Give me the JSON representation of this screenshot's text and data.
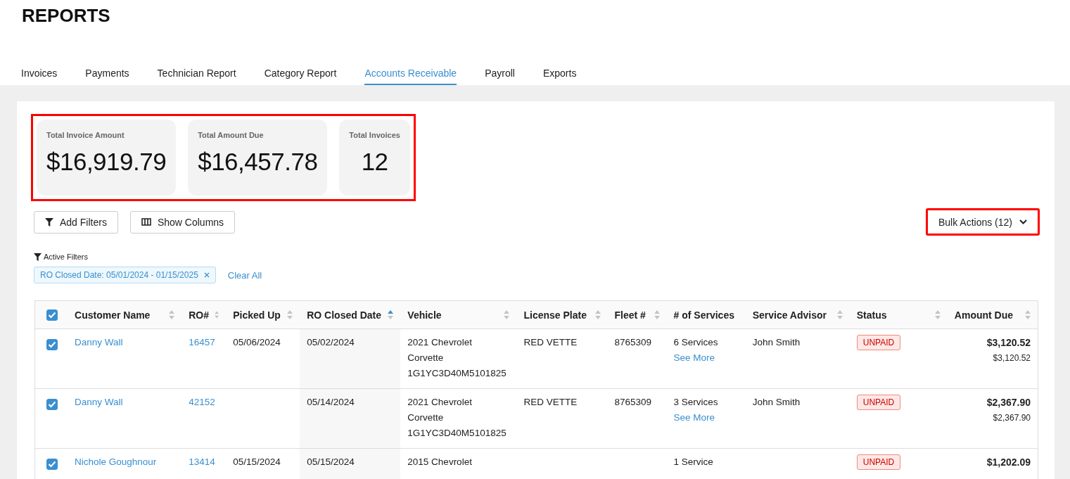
{
  "page_title": "REPORTS",
  "tabs": [
    {
      "label": "Invoices",
      "selected": false
    },
    {
      "label": "Payments",
      "selected": false
    },
    {
      "label": "Technician Report",
      "selected": false
    },
    {
      "label": "Category Report",
      "selected": false
    },
    {
      "label": "Accounts Receivable",
      "selected": true
    },
    {
      "label": "Payroll",
      "selected": false
    },
    {
      "label": "Exports",
      "selected": false
    }
  ],
  "summary": {
    "highlighted": true,
    "cards": [
      {
        "label": "Total Invoice Amount",
        "value": "$16,919.79"
      },
      {
        "label": "Total Amount Due",
        "value": "$16,457.78"
      },
      {
        "label": "Total Invoices",
        "value": "12"
      }
    ]
  },
  "toolbar": {
    "buttons": [
      {
        "label": "Add Filters",
        "kind": "filter"
      },
      {
        "label": "Show Columns",
        "kind": "columns"
      }
    ],
    "bulk_actions": {
      "label": "Bulk Actions (12)",
      "highlighted": true
    }
  },
  "active_filters": {
    "title": "Active Filters",
    "chips": [
      {
        "label": "RO Closed Date: 05/01/2024 - 01/15/2025"
      }
    ],
    "clear_label": "Clear All"
  },
  "table": {
    "select_all_checked": true,
    "columns": [
      {
        "label": "Customer Name",
        "kind": "sortable"
      },
      {
        "label": "RO#",
        "kind": "sortable"
      },
      {
        "label": "Picked Up",
        "kind": "sortable"
      },
      {
        "label": "RO Closed Date",
        "kind": "sorted"
      },
      {
        "label": "Vehicle",
        "kind": "sortable"
      },
      {
        "label": "License Plate",
        "kind": "sortable"
      },
      {
        "label": "Fleet #",
        "kind": "sortable"
      },
      {
        "label": "# of Services",
        "kind": "plain"
      },
      {
        "label": "Service Advisor",
        "kind": "sortable"
      },
      {
        "label": "Status",
        "kind": "sortable"
      },
      {
        "label": "Amount Due",
        "kind": "sortable"
      }
    ],
    "rows": [
      {
        "checked": true,
        "customer": "Danny Wall",
        "ro": "16457",
        "picked_up": "05/06/2024",
        "closed_date": "05/02/2024",
        "vehicle": "2021 Chevrolet Corvette 1G1YC3D40M5101825",
        "license_plate": "RED VETTE",
        "fleet": "8765309",
        "services": "6 Services",
        "see_more": "See More",
        "advisor": "John Smith",
        "status": "UNPAID",
        "amount_due": "$3,120.52",
        "amount_detail": "$3,120.52"
      },
      {
        "checked": true,
        "customer": "Danny Wall",
        "ro": "42152",
        "closed_date": "05/14/2024",
        "vehicle": "2021 Chevrolet Corvette 1G1YC3D40M5101825",
        "license_plate": "RED VETTE",
        "fleet": "8765309",
        "services": "3 Services",
        "see_more": "See More",
        "advisor": "John Smith",
        "status": "UNPAID",
        "amount_due": "$2,367.90",
        "amount_detail": "$2,367.90"
      },
      {
        "checked": true,
        "customer": "Nichole Goughnour",
        "ro": "13414",
        "picked_up": "05/15/2024",
        "closed_date": "05/15/2024",
        "vehicle": "2015 Chevrolet",
        "services": "1 Service",
        "status": "UNPAID",
        "amount_due": "$1,202.09"
      }
    ]
  }
}
